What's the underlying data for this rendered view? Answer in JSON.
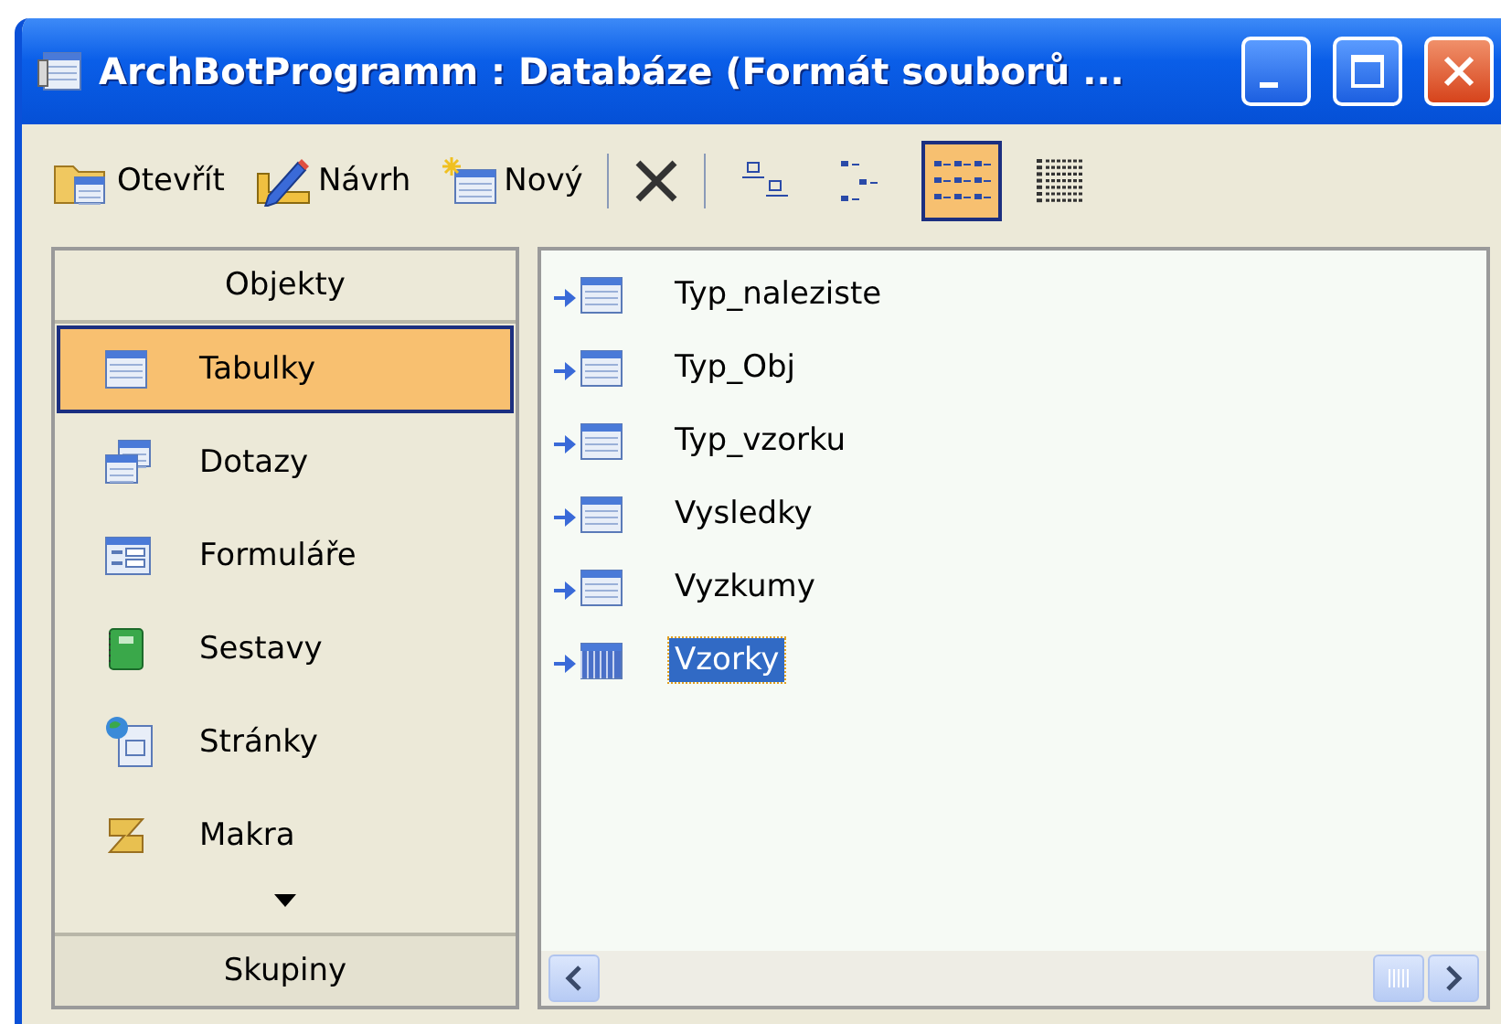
{
  "window": {
    "title": "ArchBotProgramm : Databáze (Formát souborů ..."
  },
  "toolbar": {
    "actions": [
      {
        "kind": "open",
        "label": "Otevřít"
      },
      {
        "kind": "design",
        "label": "Návrh"
      },
      {
        "kind": "new",
        "label": "Nový"
      },
      {
        "kind": "delete"
      }
    ],
    "views": [
      {
        "kind": "large",
        "selected": false
      },
      {
        "kind": "small",
        "selected": false
      },
      {
        "kind": "list",
        "selected": true
      },
      {
        "kind": "details",
        "selected": false
      }
    ]
  },
  "sidebar": {
    "header": "Objekty",
    "items": [
      {
        "kind": "table",
        "label": "Tabulky",
        "selected": true
      },
      {
        "kind": "query",
        "label": "Dotazy",
        "selected": false
      },
      {
        "kind": "form",
        "label": "Formuláře",
        "selected": false
      },
      {
        "kind": "report",
        "label": "Sestavy",
        "selected": false
      },
      {
        "kind": "page",
        "label": "Stránky",
        "selected": false
      },
      {
        "kind": "macro",
        "label": "Makra",
        "selected": false
      }
    ],
    "footer": "Skupiny"
  },
  "list": {
    "items": [
      {
        "label": "Typ_naleziste",
        "selected": false
      },
      {
        "label": "Typ_Obj",
        "selected": false
      },
      {
        "label": "Typ_vzorku",
        "selected": false
      },
      {
        "label": "Vysledky",
        "selected": false
      },
      {
        "label": "Vyzkumy",
        "selected": false
      },
      {
        "label": "Vzorky",
        "selected": true
      }
    ]
  }
}
